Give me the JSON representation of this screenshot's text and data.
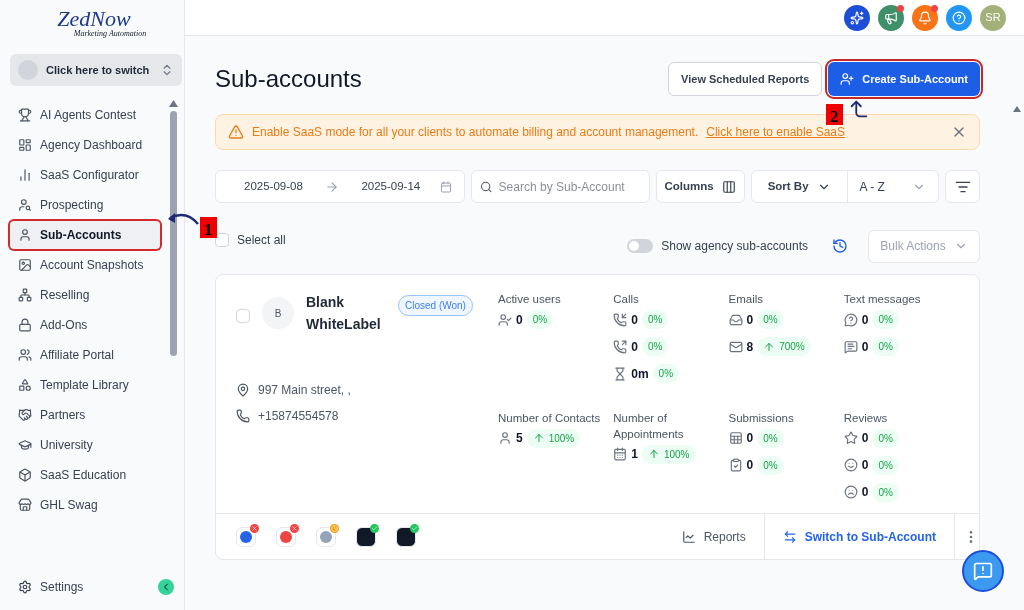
{
  "brand": {
    "name": "ZedNow",
    "tagline": "Marketing Automation"
  },
  "switcher": {
    "label": "Click here to switch"
  },
  "sidebar": {
    "items": [
      {
        "label": "AI Agents Contest",
        "selected": false,
        "highlighted": false
      },
      {
        "label": "Agency Dashboard",
        "selected": false,
        "highlighted": false
      },
      {
        "label": "SaaS Configurator",
        "selected": false,
        "highlighted": false
      },
      {
        "label": "Prospecting",
        "selected": false,
        "highlighted": false
      },
      {
        "label": "Sub-Accounts",
        "selected": true,
        "highlighted": true
      },
      {
        "label": "Account Snapshots",
        "selected": false,
        "highlighted": false
      },
      {
        "label": "Reselling",
        "selected": false,
        "highlighted": false
      },
      {
        "label": "Add-Ons",
        "selected": false,
        "highlighted": false
      },
      {
        "label": "Affiliate Portal",
        "selected": false,
        "highlighted": false
      },
      {
        "label": "Template Library",
        "selected": false,
        "highlighted": false
      },
      {
        "label": "Partners",
        "selected": false,
        "highlighted": false
      },
      {
        "label": "University",
        "selected": false,
        "highlighted": false
      },
      {
        "label": "SaaS Education",
        "selected": false,
        "highlighted": false
      },
      {
        "label": "GHL Swag",
        "selected": false,
        "highlighted": false
      }
    ],
    "settings": "Settings"
  },
  "topbar": {
    "buttons": [
      {
        "color": "#1d4ed8",
        "badge": false
      },
      {
        "color": "#3f8f6b",
        "badge": true
      },
      {
        "color": "#f97316",
        "badge": true
      },
      {
        "color": "#2196f3",
        "badge": false
      }
    ],
    "avatar": "SR"
  },
  "page": {
    "title": "Sub-accounts",
    "buttons": [
      {
        "label": "View Scheduled Reports",
        "kind": "secondary",
        "highlighted": false
      },
      {
        "label": "Create Sub-Account",
        "kind": "primary",
        "highlighted": true
      }
    ]
  },
  "banner": {
    "text": "Enable SaaS mode for all your clients to automate billing and account management.",
    "link": "Click here to enable SaaS"
  },
  "filters": {
    "date_from": "2025-09-08",
    "date_to": "2025-09-14",
    "search_placeholder": "Search by Sub-Account",
    "columns": "Columns",
    "sort_label": "Sort By",
    "sort_value": "A - Z"
  },
  "list_controls": {
    "select_all": {
      "label": "Select all",
      "checked": false
    },
    "agency_toggle": {
      "label": "Show agency sub-accounts",
      "on": false
    },
    "bulk_actions": {
      "label": "Bulk Actions",
      "disabled": true
    }
  },
  "account": {
    "checked": false,
    "initial": "B",
    "name": "Blank WhiteLabel",
    "status": "Closed (Won)",
    "address": "997 Main street, ,",
    "phone": "+15874554578",
    "stats": [
      {
        "label": "Active users",
        "rows": [
          {
            "value": "0",
            "change": "0%",
            "up": false
          }
        ]
      },
      {
        "label": "Calls",
        "rows": [
          {
            "value": "0",
            "change": "0%",
            "up": false
          },
          {
            "value": "0",
            "change": "0%",
            "up": false
          },
          {
            "value": "0m",
            "change": "0%",
            "up": false
          }
        ]
      },
      {
        "label": "Emails",
        "rows": [
          {
            "value": "0",
            "change": "0%",
            "up": false
          },
          {
            "value": "8",
            "change": "700%",
            "up": true
          }
        ]
      },
      {
        "label": "Text messages",
        "rows": [
          {
            "value": "0",
            "change": "0%",
            "up": false
          },
          {
            "value": "0",
            "change": "0%",
            "up": false
          }
        ]
      },
      {
        "label": "Number of Contacts",
        "rows": [
          {
            "value": "5",
            "change": "100%",
            "up": true
          }
        ]
      },
      {
        "label": "Number of Appointments",
        "rows": [
          {
            "value": "1",
            "change": "100%",
            "up": true
          }
        ]
      },
      {
        "label": "Submissions",
        "rows": [
          {
            "value": "0",
            "change": "0%",
            "up": false
          },
          {
            "value": "0",
            "change": "0%",
            "up": false
          }
        ]
      },
      {
        "label": "Reviews",
        "rows": [
          {
            "value": "0",
            "change": "0%",
            "up": false
          },
          {
            "value": "0",
            "change": "0%",
            "up": false
          },
          {
            "value": "0",
            "change": "0%",
            "up": false
          }
        ]
      }
    ],
    "integrations": [
      {
        "kind": "error"
      },
      {
        "kind": "error"
      },
      {
        "kind": "pending"
      },
      {
        "kind": "ok"
      },
      {
        "kind": "ok"
      }
    ],
    "actions": [
      "Reports",
      "Switch to Sub-Account"
    ]
  },
  "annotations": [
    {
      "label": "1"
    },
    {
      "label": "2"
    }
  ]
}
